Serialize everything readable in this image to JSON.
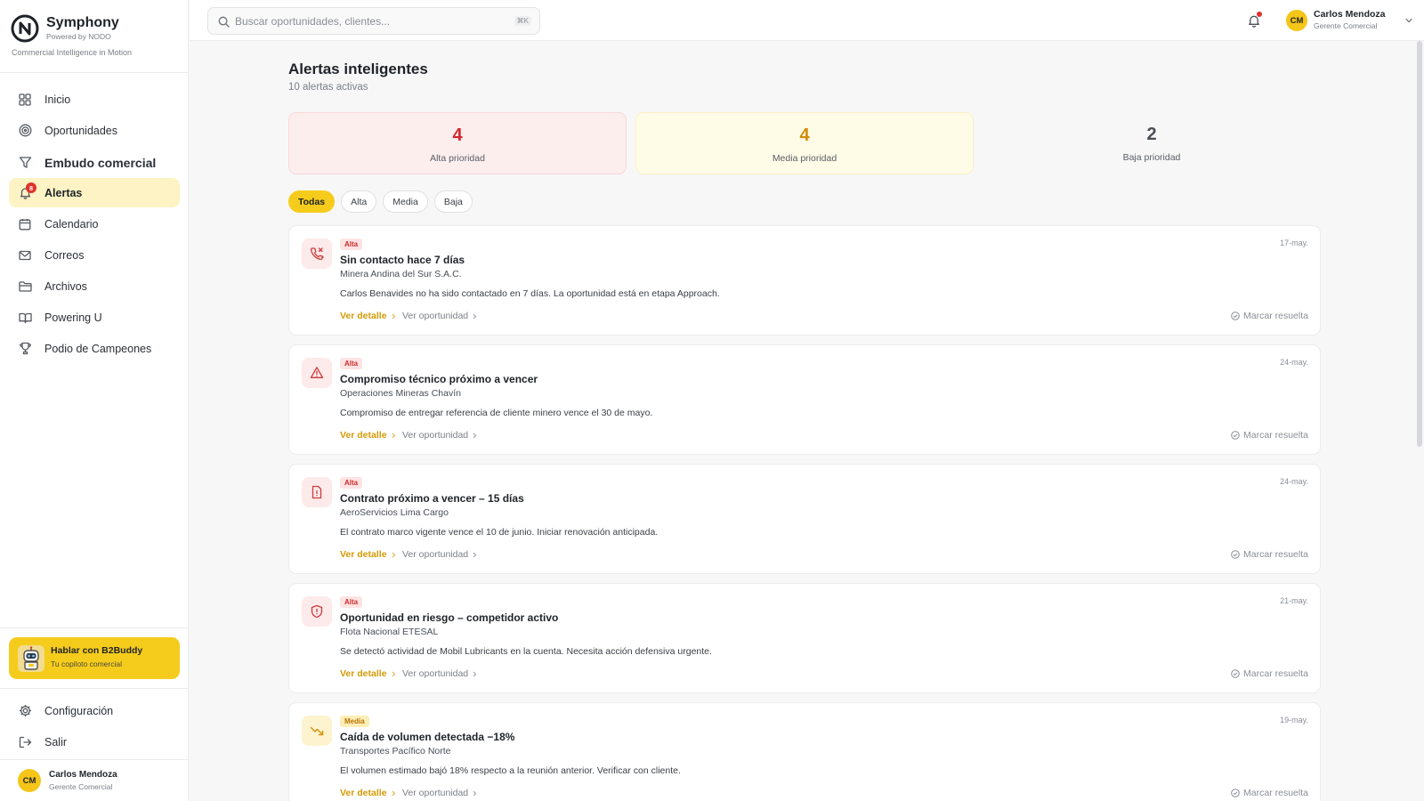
{
  "brand": {
    "name": "Symphony",
    "powered_by": "Powered by NODO",
    "tagline": "Commercial Intelligence in Motion"
  },
  "sidebar": {
    "items": [
      {
        "label": "Inicio",
        "icon": "grid-icon"
      },
      {
        "label": "Oportunidades",
        "icon": "target-icon"
      },
      {
        "label": "Embudo comercial",
        "icon": "funnel-icon"
      },
      {
        "label": "Alertas",
        "icon": "bell-icon",
        "badge": "8"
      },
      {
        "label": "Calendario",
        "icon": "calendar-icon"
      },
      {
        "label": "Correos",
        "icon": "mail-icon"
      },
      {
        "label": "Archivos",
        "icon": "folder-icon"
      },
      {
        "label": "Powering U",
        "icon": "book-icon"
      },
      {
        "label": "Podio de Campeones",
        "icon": "trophy-icon"
      }
    ],
    "buddy": {
      "title": "Hablar con B2Buddy",
      "subtitle": "Tu copiloto comercial"
    },
    "bottom": [
      {
        "label": "Configuración",
        "icon": "gear-icon"
      },
      {
        "label": "Salir",
        "icon": "logout-icon"
      }
    ],
    "user": {
      "initials": "CM",
      "name": "Carlos Mendoza",
      "role": "Gerente Comercial"
    }
  },
  "topbar": {
    "search_placeholder": "Buscar oportunidades, clientes...",
    "search_shortcut": "⌘K",
    "user": {
      "initials": "CM",
      "name": "Carlos Mendoza",
      "role": "Gerente Comercial"
    }
  },
  "main": {
    "title": "Alertas inteligentes",
    "subtitle": "10 alertas activas",
    "stats": [
      {
        "value": "4",
        "label": "Alta prioridad"
      },
      {
        "value": "4",
        "label": "Media prioridad"
      },
      {
        "value": "2",
        "label": "Baja prioridad"
      }
    ],
    "filters": [
      "Todas",
      "Alta",
      "Media",
      "Baja"
    ],
    "active_filter": "Todas",
    "actions": {
      "detail": "Ver detalle",
      "opportunity": "Ver oportunidad",
      "resolve": "Marcar resuelta"
    },
    "alerts": [
      {
        "priority": "Alta",
        "icon": "phone-missed-icon",
        "title": "Sin contacto hace 7 días",
        "client": "Minera Andina del Sur S.A.C.",
        "description": "Carlos Benavides no ha sido contactado en 7 días. La oportunidad está en etapa Approach.",
        "date": "17-may."
      },
      {
        "priority": "Alta",
        "icon": "warning-triangle-icon",
        "title": "Compromiso técnico próximo a vencer",
        "client": "Operaciones Mineras Chavín",
        "description": "Compromiso de entregar referencia de cliente minero vence el 30 de mayo.",
        "date": "24-may."
      },
      {
        "priority": "Alta",
        "icon": "document-alert-icon",
        "title": "Contrato próximo a vencer – 15 días",
        "client": "AeroServicios Lima Cargo",
        "description": "El contrato marco vigente vence el 10 de junio. Iniciar renovación anticipada.",
        "date": "24-may."
      },
      {
        "priority": "Alta",
        "icon": "shield-alert-icon",
        "title": "Oportunidad en riesgo – competidor activo",
        "client": "Flota Nacional ETESAL",
        "description": "Se detectó actividad de Mobil Lubricants en la cuenta. Necesita acción defensiva urgente.",
        "date": "21-may."
      },
      {
        "priority": "Media",
        "icon": "trending-down-icon",
        "title": "Caída de volumen detectada −18%",
        "client": "Transportes Pacífico Norte",
        "description": "El volumen estimado bajó 18% respecto a la reunión anterior. Verificar con cliente.",
        "date": "19-may."
      }
    ]
  },
  "colors": {
    "accent": "#f6cc1c",
    "high": "#d4262b",
    "medium": "#d48a08",
    "low": "#4a4e55"
  }
}
